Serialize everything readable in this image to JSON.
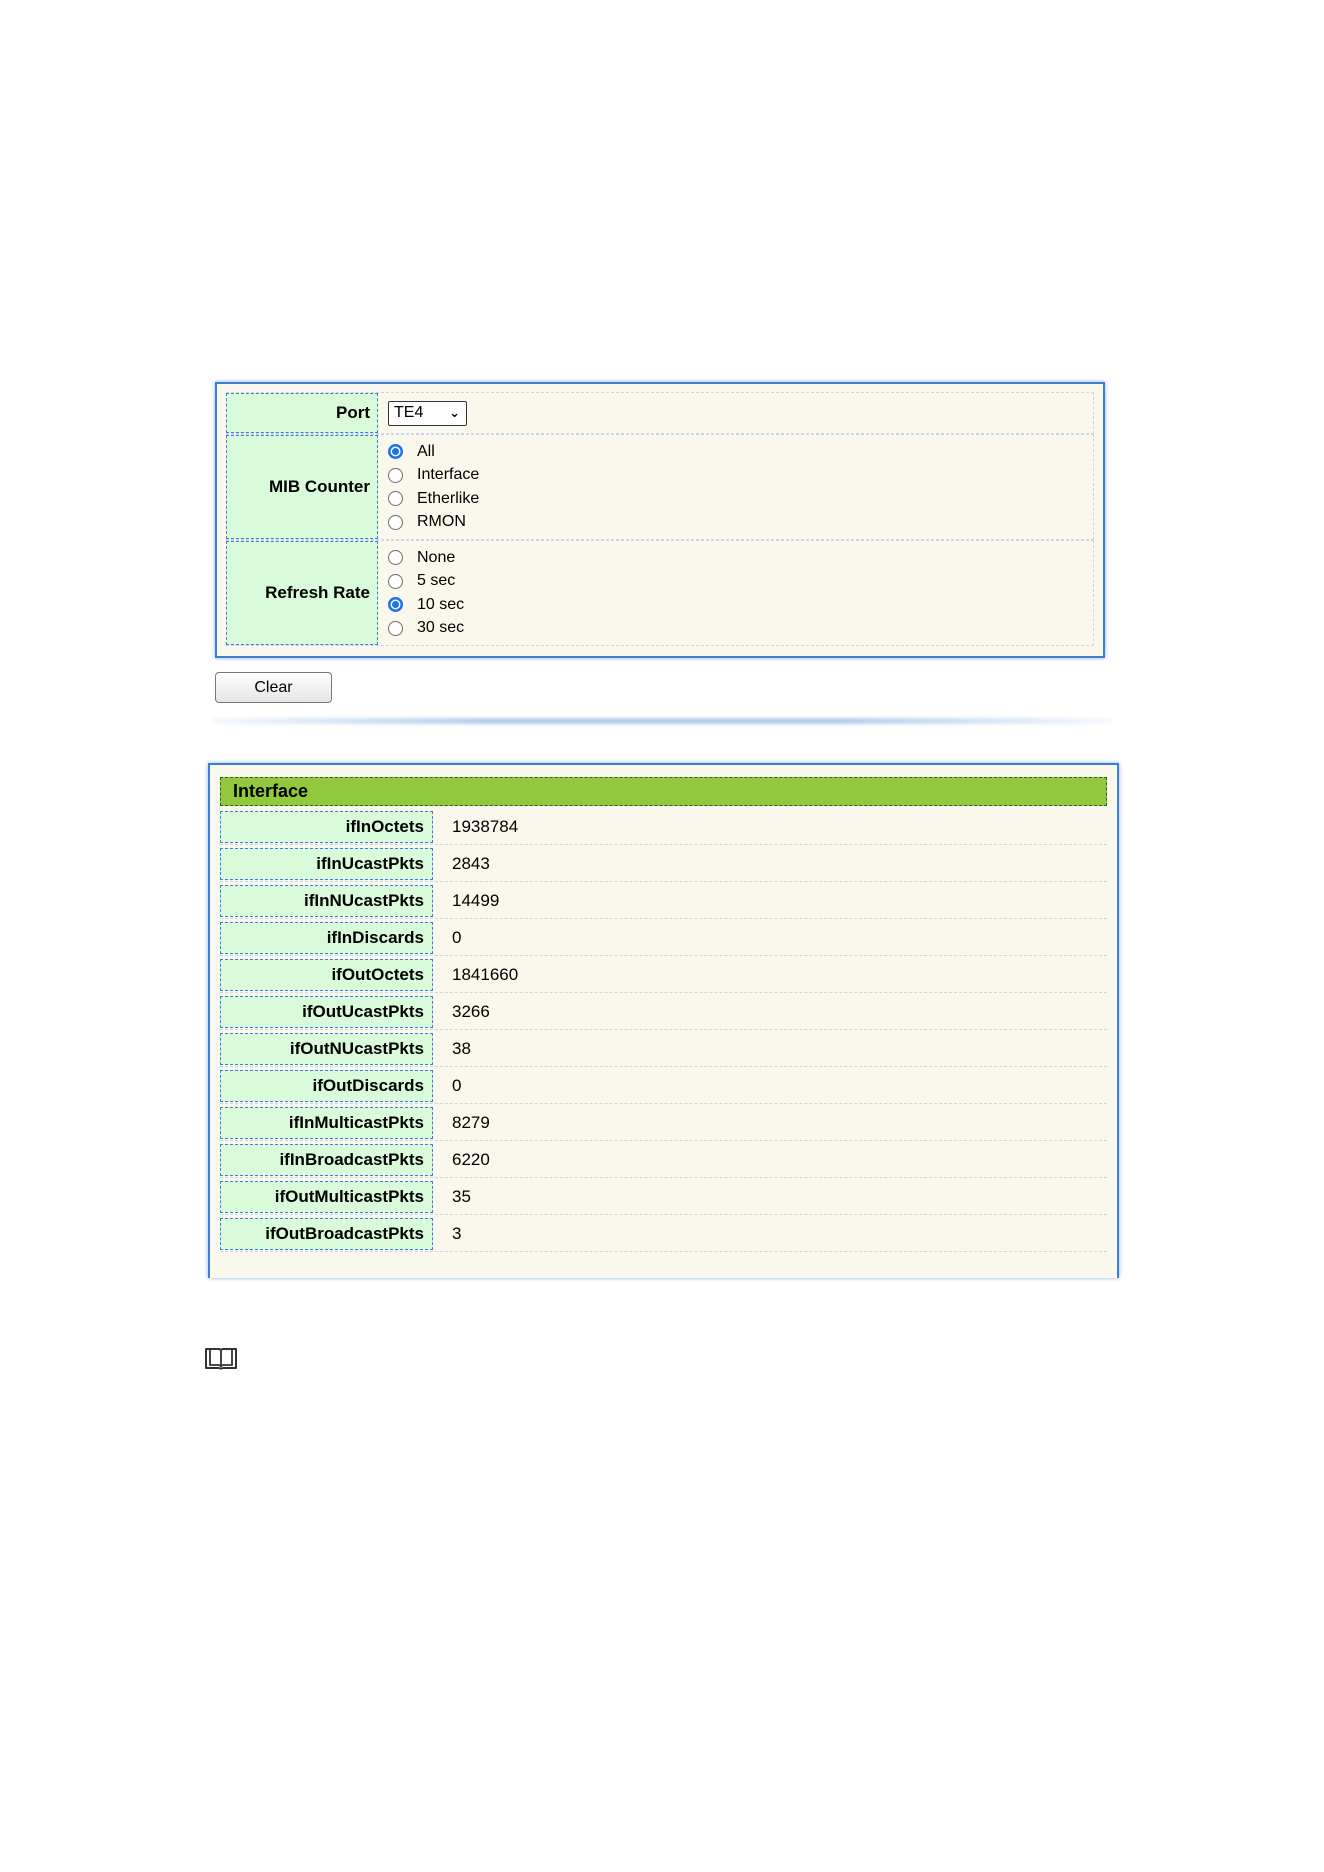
{
  "settings": {
    "port": {
      "label": "Port",
      "selected": "TE4"
    },
    "mib_counter": {
      "label": "MIB Counter",
      "options": [
        {
          "label": "All",
          "checked": true
        },
        {
          "label": "Interface",
          "checked": false
        },
        {
          "label": "Etherlike",
          "checked": false
        },
        {
          "label": "RMON",
          "checked": false
        }
      ]
    },
    "refresh_rate": {
      "label": "Refresh Rate",
      "options": [
        {
          "label": "None",
          "checked": false
        },
        {
          "label": "5 sec",
          "checked": false
        },
        {
          "label": "10 sec",
          "checked": true
        },
        {
          "label": "30 sec",
          "checked": false
        }
      ]
    },
    "clear_label": "Clear"
  },
  "interface": {
    "title": "Interface",
    "counters": [
      {
        "name": "ifInOctets",
        "value": "1938784"
      },
      {
        "name": "ifInUcastPkts",
        "value": "2843"
      },
      {
        "name": "ifInNUcastPkts",
        "value": "14499"
      },
      {
        "name": "ifInDiscards",
        "value": "0"
      },
      {
        "name": "ifOutOctets",
        "value": "1841660"
      },
      {
        "name": "ifOutUcastPkts",
        "value": "3266"
      },
      {
        "name": "ifOutNUcastPkts",
        "value": "38"
      },
      {
        "name": "ifOutDiscards",
        "value": "0"
      },
      {
        "name": "ifInMulticastPkts",
        "value": "8279"
      },
      {
        "name": "ifInBroadcastPkts",
        "value": "6220"
      },
      {
        "name": "ifOutMulticastPkts",
        "value": "35"
      },
      {
        "name": "ifOutBroadcastPkts",
        "value": "3"
      }
    ]
  },
  "note_icon": "book-icon",
  "colors": {
    "accent_blue": "#3d7fd6",
    "label_bg": "#d9fbd9",
    "panel_bg": "#faf7ec",
    "header_green": "#92c83e",
    "radio_checked": "#1a73e8"
  }
}
